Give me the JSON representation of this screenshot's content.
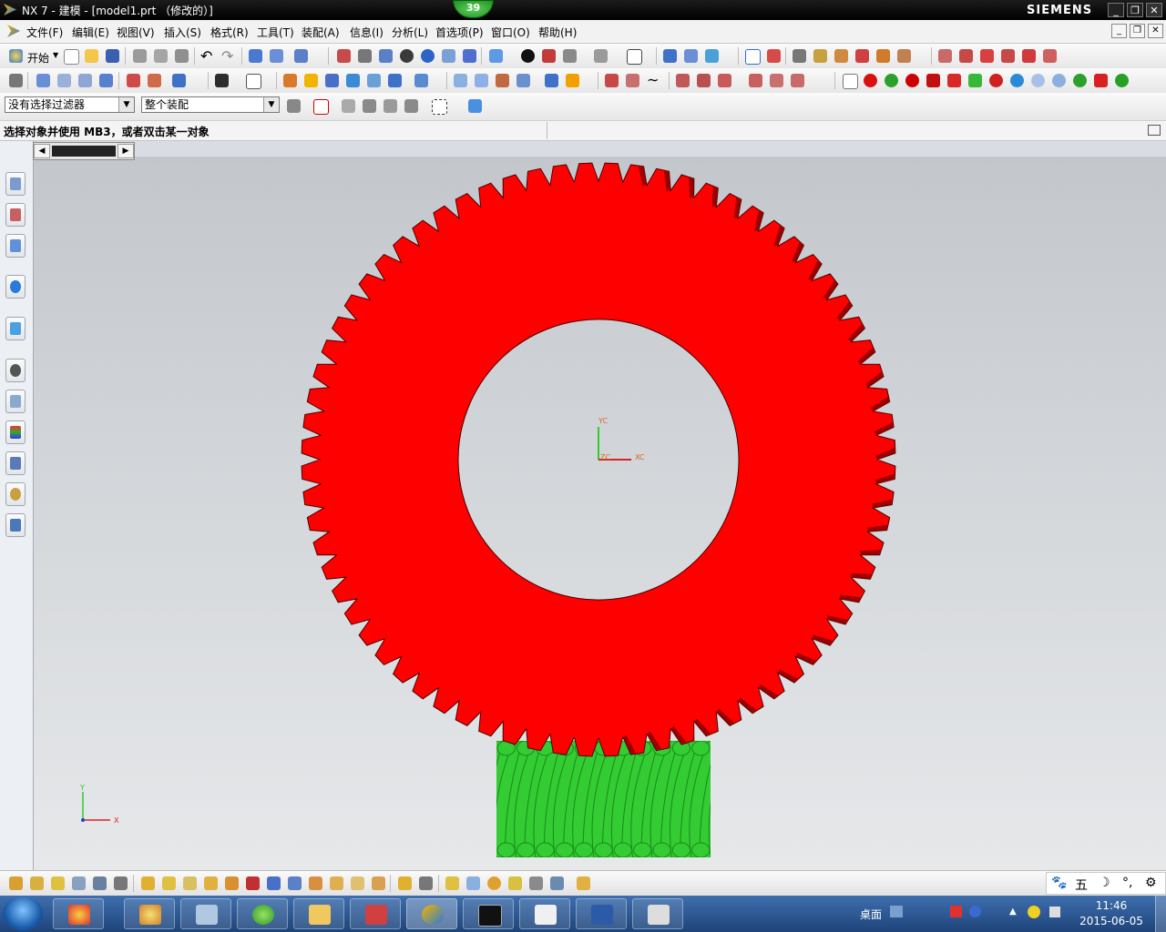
{
  "window": {
    "title": "NX 7 - 建模 - [model1.prt （修改的）]",
    "brand": "SIEMENS",
    "badge": "39",
    "controls": [
      "_",
      "❐",
      "✕"
    ]
  },
  "menu": {
    "items": [
      "文件(F)",
      "编辑(E)",
      "视图(V)",
      "插入(S)",
      "格式(R)",
      "工具(T)",
      "装配(A)",
      "信息(I)",
      "分析(L)",
      "首选项(P)",
      "窗口(O)",
      "帮助(H)"
    ],
    "mdi_controls": [
      "_",
      "❐",
      "✕"
    ]
  },
  "toolbar1": {
    "start_label": "开始"
  },
  "selection_bar": {
    "filter_value": "没有选择过滤器",
    "scope_value": "整个装配"
  },
  "cue": {
    "text": "选择对象并使用 MB3，或者双击某一对象"
  },
  "viewport": {
    "wcs": {
      "x_label": "XC",
      "y_label": "YC",
      "z_label": "ZC"
    },
    "abs_triad": {
      "x_label": "X",
      "y_label": "Y"
    },
    "colors": {
      "gear": "#ff0000",
      "gear_dark": "#8a0000",
      "worm": "#33cc33",
      "worm_dark": "#1a8a1a",
      "background_top": "#c3c7cc",
      "background_bottom": "#e6e8ea"
    },
    "gear_teeth": 72,
    "worm_threads": 11
  },
  "ime": {
    "items": [
      "🐾",
      "五",
      "☽",
      "°,",
      "⚙"
    ]
  },
  "taskbar": {
    "desktop_label": "桌面",
    "clock_time": "11:46",
    "clock_date": "2015-06-05",
    "apps": [
      "files-icon",
      "paint-icon",
      "calculator-icon",
      "browser-icon",
      "explorer-icon",
      "tool-icon",
      "nx-icon",
      "console-icon",
      "folder-icon",
      "word-icon",
      "ggg-icon"
    ]
  }
}
